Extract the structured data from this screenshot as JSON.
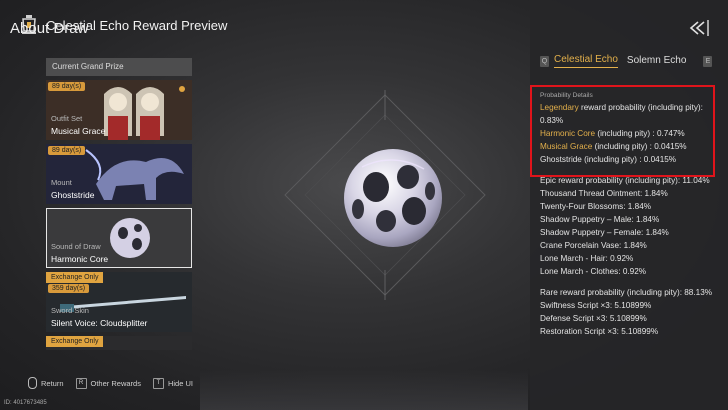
{
  "header": {
    "title": "Celestial Echo Reward Preview",
    "logo_icon": "lantern-logo-icon"
  },
  "left_panel": {
    "grand_prize_label": "Current Grand Prize",
    "cards": [
      {
        "badge": "89 day(s)",
        "type": "Outfit Set",
        "name": "Musical Grace"
      },
      {
        "badge": "89 day(s)",
        "type": "Mount",
        "name": "Ghoststride"
      },
      {
        "badge": "",
        "type": "Sound of Draw",
        "name": "Harmonic Core",
        "selected": true
      },
      {
        "exclusive": "Exchange Only",
        "badge": "359 day(s)",
        "type": "Sword Skin",
        "name": "Silent Voice: Cloudsplitter"
      },
      {
        "exclusive": "Exchange Only",
        "badge": "",
        "type": "",
        "name": ""
      }
    ]
  },
  "hints": {
    "return": "Return",
    "other_rewards": "Other Rewards",
    "hide_ui": "Hide UI",
    "key_r": "R",
    "key_t": "T"
  },
  "uid": "ID: 4017673485",
  "right_panel": {
    "title": "About Draw",
    "tab_key_left": "Q",
    "tab_active": "Celestial Echo",
    "tab_other": "Solemn Echo",
    "tab_key_right": "E",
    "section_header": "Probability Details",
    "legendary": {
      "label": "Legendary",
      "rest": " reward probability (including pity): 0.83%",
      "items": [
        {
          "name": "Harmonic Core",
          "rest": " (including pity) : 0.747%"
        },
        {
          "name": "Musical Grace",
          "rest": " (including pity) : 0.0415%"
        },
        {
          "name": "Ghoststride",
          "rest": " (including pity) : 0.0415%"
        }
      ]
    },
    "epic": {
      "header": "Epic reward probability (including pity): 11.04%",
      "items": [
        "Thousand Thread Ointment: 1.84%",
        "Twenty-Four Blossoms: 1.84%",
        "Shadow Puppetry – Male: 1.84%",
        "Shadow Puppetry – Female: 1.84%",
        "Crane Porcelain Vase: 1.84%",
        "Lone March - Hair: 0.92%",
        "Lone March - Clothes: 0.92%"
      ]
    },
    "rare": {
      "header": "Rare reward probability (including pity): 88.13%",
      "items": [
        "Swiftness Script ×3: 5.10899%",
        "Defense Script ×3: 5.10899%",
        "Restoration Script ×3: 5.10899%"
      ]
    }
  },
  "colors": {
    "accent_gold": "#e3b04b",
    "highlight_red": "#e0141b",
    "badge_orange": "#d89a3b"
  }
}
